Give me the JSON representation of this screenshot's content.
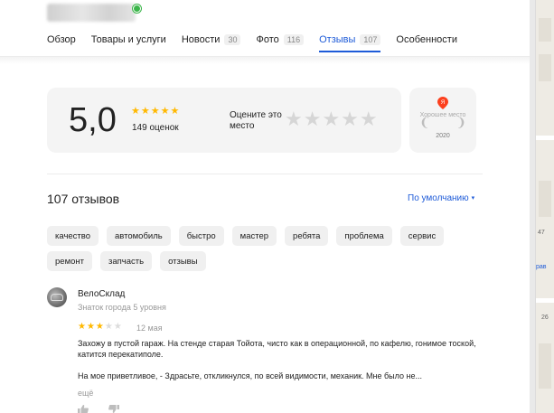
{
  "header": {
    "tabs": [
      {
        "label": "Обзор"
      },
      {
        "label": "Товары и услуги"
      },
      {
        "label": "Новости",
        "count": "30"
      },
      {
        "label": "Фото",
        "count": "116"
      },
      {
        "label": "Отзывы",
        "count": "107"
      },
      {
        "label": "Особенности"
      }
    ],
    "active_tab": "Отзывы"
  },
  "rating": {
    "value": "5,0",
    "stars": "★★★★★",
    "count_text": "149 оценок",
    "rate_prompt": "Оцените это место",
    "rate_stars": "★★★★★"
  },
  "badge": {
    "logo_letter": "Я",
    "text": "Хорошее место",
    "year": "2020"
  },
  "reviews": {
    "title": "107 отзывов",
    "sort_label": "По умолчанию",
    "sort_caret": "▾",
    "chips": [
      "качество",
      "автомобиль",
      "быстро",
      "мастер",
      "ребята",
      "проблема",
      "сервис",
      "ремонт",
      "запчасть",
      "отзывы"
    ],
    "items": [
      {
        "author": "ВелоСклад",
        "level": "Знаток города 5 уровня",
        "stars_on": "★★★",
        "stars_off": "★★",
        "rating": 3,
        "date": "12 мая",
        "paragraph1": "Захожу в пустой гараж. На стенде старая Тойота, чисто как в операционной, по кафелю, гонимое тоской, катится перекатиполе.",
        "paragraph2": "На мое приветливое, - Здрасьте, откликнулся, по всей видимости, механик. Мне было не...",
        "more": "ещё"
      }
    ]
  },
  "map": {
    "labels": [
      "47",
      "рав",
      "26"
    ]
  },
  "colors": {
    "accent": "#1e5bd8",
    "star": "#ffb800",
    "verified": "#3bb54a",
    "yandex_red": "#fc3f1d"
  }
}
